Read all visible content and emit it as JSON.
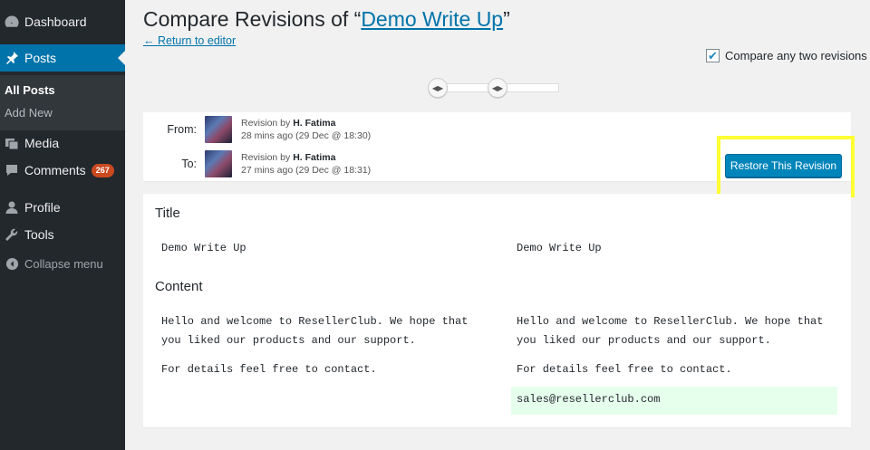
{
  "sidebar": {
    "items": [
      {
        "label": "Dashboard",
        "icon": "dashboard-icon"
      },
      {
        "label": "Posts",
        "icon": "pin-icon"
      },
      {
        "label": "Media",
        "icon": "media-icon"
      },
      {
        "label": "Comments",
        "icon": "comment-icon",
        "badge": "267"
      },
      {
        "label": "Profile",
        "icon": "user-icon"
      },
      {
        "label": "Tools",
        "icon": "wrench-icon"
      },
      {
        "label": "Collapse menu",
        "icon": "collapse-icon"
      }
    ],
    "posts_submenu": [
      "All Posts",
      "Add New"
    ]
  },
  "header": {
    "title_prefix": "Compare Revisions of “",
    "post_title": "Demo Write Up",
    "title_suffix": "”",
    "return_link": "← Return to editor",
    "compare_any_label": "Compare any two revisions",
    "compare_any_checked": true
  },
  "revisions": {
    "from": {
      "label": "From:",
      "by_prefix": "Revision by",
      "author": "H. Fatima",
      "time": "28 mins ago (29 Dec @ 18:30)"
    },
    "to": {
      "label": "To:",
      "by_prefix": "Revision by",
      "author": "H. Fatima",
      "time": "27 mins ago (29 Dec @ 18:31)"
    },
    "restore_label": "Restore This Revision"
  },
  "diff": {
    "title_heading": "Title",
    "title_left": "Demo Write Up",
    "title_right": "Demo Write Up",
    "content_heading": "Content",
    "left": {
      "line1": "Hello and welcome to ResellerClub. We hope that",
      "line2": "you liked our products and our support.",
      "line3": "For details feel free to contact."
    },
    "right": {
      "line1": "Hello and welcome to ResellerClub. We hope that",
      "line2": "you liked our products and our support.",
      "line3": "For details feel free to contact.",
      "added_line": "sales@resellerclub.com"
    }
  },
  "colors": {
    "accent": "#0073aa",
    "button": "#0085ba",
    "highlight": "#ffff33",
    "added_bg": "#e6ffed",
    "sidebar": "#23282d"
  }
}
